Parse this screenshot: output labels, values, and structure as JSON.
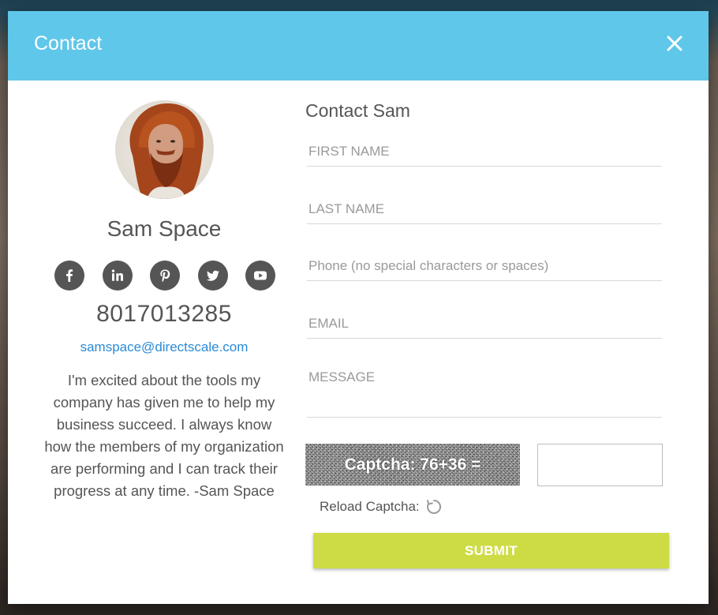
{
  "modal": {
    "title": "Contact"
  },
  "profile": {
    "name": "Sam Space",
    "phone": "8017013285",
    "email": "samspace@directscale.com",
    "bio": "I'm excited about the tools my company has given me to help my business succeed. I always know how the members of my organization are performing and I can track their progress at any time. -Sam Space",
    "social": [
      {
        "icon": "facebook-icon"
      },
      {
        "icon": "linkedin-icon"
      },
      {
        "icon": "pinterest-icon"
      },
      {
        "icon": "twitter-icon"
      },
      {
        "icon": "youtube-icon"
      }
    ]
  },
  "form": {
    "title": "Contact Sam",
    "first_name_placeholder": "FIRST NAME",
    "last_name_placeholder": "LAST NAME",
    "phone_placeholder": "Phone (no special characters or spaces)",
    "email_placeholder": "EMAIL",
    "message_placeholder": "MESSAGE",
    "captcha_text": "Captcha: 76+36 =",
    "captcha_value": "",
    "reload_label": "Reload Captcha:",
    "submit_label": "SUBMIT"
  },
  "colors": {
    "header": "#5fc7e9",
    "submit": "#cddc45",
    "link": "#2a8ad8",
    "text": "#555555"
  }
}
